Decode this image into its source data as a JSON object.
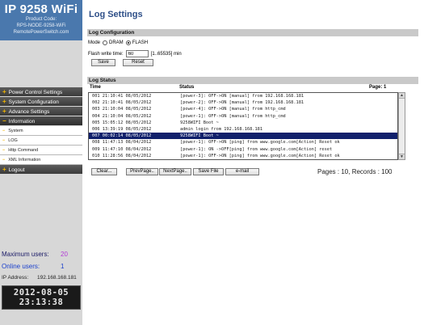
{
  "brand": {
    "title": "IP 9258 WiFi",
    "product_code": "Product Code:",
    "product_model": "RPS-NODE-9258-WiFi",
    "website": "RemotePowerSwitch.com"
  },
  "sidebar": {
    "menu": [
      {
        "label": "Power Control Settings",
        "expanded": false
      },
      {
        "label": "System Configuration",
        "expanded": false
      },
      {
        "label": "Advance Settings",
        "expanded": false
      },
      {
        "label": "Information",
        "expanded": true
      }
    ],
    "submenu": [
      "System",
      "LOG",
      "Http Command",
      "XML Information"
    ],
    "logout": "Logout",
    "stats": {
      "max_users_label": "Maximum users:",
      "max_users_value": "20",
      "online_users_label": "Online users:",
      "online_users_value": "1",
      "ip_label": "IP Address:",
      "ip_value": "192.168.168.181"
    },
    "clock": {
      "date": "2012-08-05",
      "time": "23:13:38"
    }
  },
  "main": {
    "page_title": "Log Settings",
    "log_config": {
      "header": "Log Configuration",
      "mode_label": "Mode",
      "mode_options": [
        "DRAM",
        "FLASH"
      ],
      "mode_selected": "FLASH",
      "flash_write_time_label": "Flash write time:",
      "flash_write_time_value": "60",
      "flash_write_time_hint": "[1..65535] min",
      "save_label": "Save",
      "reset_label": "Reset"
    },
    "log_status": {
      "header": "Log Status",
      "col_time": "Time",
      "col_status": "Status",
      "page_label": "Page: 1",
      "rows": [
        {
          "time": "001 21:10:41 08/05/2012",
          "status": "[power-3]: OFF->ON [manual] from 192.168.168.181"
        },
        {
          "time": "002 21:10:41 08/05/2012",
          "status": "[power-2]: OFF->ON [manual] from 192.168.168.181"
        },
        {
          "time": "003 21:10:04 08/05/2012",
          "status": "[power-4]: OFF->ON [manual] from http_cmd"
        },
        {
          "time": "004 21:10:04 08/05/2012",
          "status": "[power-1]: OFF->ON [manual] from http_cmd"
        },
        {
          "time": "005 15:05:12 08/05/2012",
          "status": "9258WIFI Boot ~"
        },
        {
          "time": "006 13:39:19 08/05/2012",
          "status": "admin login from 192.168.168.181"
        },
        {
          "time": "007 00:02:14 08/05/2012",
          "status": "9258WIFI Boot ~"
        },
        {
          "time": "008 11:47:13 08/04/2012",
          "status": "[power-1]: OFF->ON [ping] from www.google.com[Action] Reset ok"
        },
        {
          "time": "009 11:47:10 08/04/2012",
          "status": "[power-1]: ON ->OFF[ping] from www.google.com[Action] reset"
        },
        {
          "time": "010 11:28:56 08/04/2012",
          "status": "[power-1]: OFF->ON [ping] from www.google.com[Action] Reset ok"
        }
      ],
      "selected_row": 6,
      "buttons": {
        "clear": "Clear...",
        "prev_page": "PrevPage..",
        "next_page": "NextPage..",
        "save_file": "Save File",
        "email": "e-mail"
      },
      "pages_summary": "Pages : 10, Records : 100"
    }
  },
  "colors": {
    "brand_bg": "#4a78ad",
    "title_blue": "#2e4f88",
    "selected_row": "#10206b",
    "menu_bg": "#3a3a3a",
    "accent_plus": "#f0b400"
  }
}
